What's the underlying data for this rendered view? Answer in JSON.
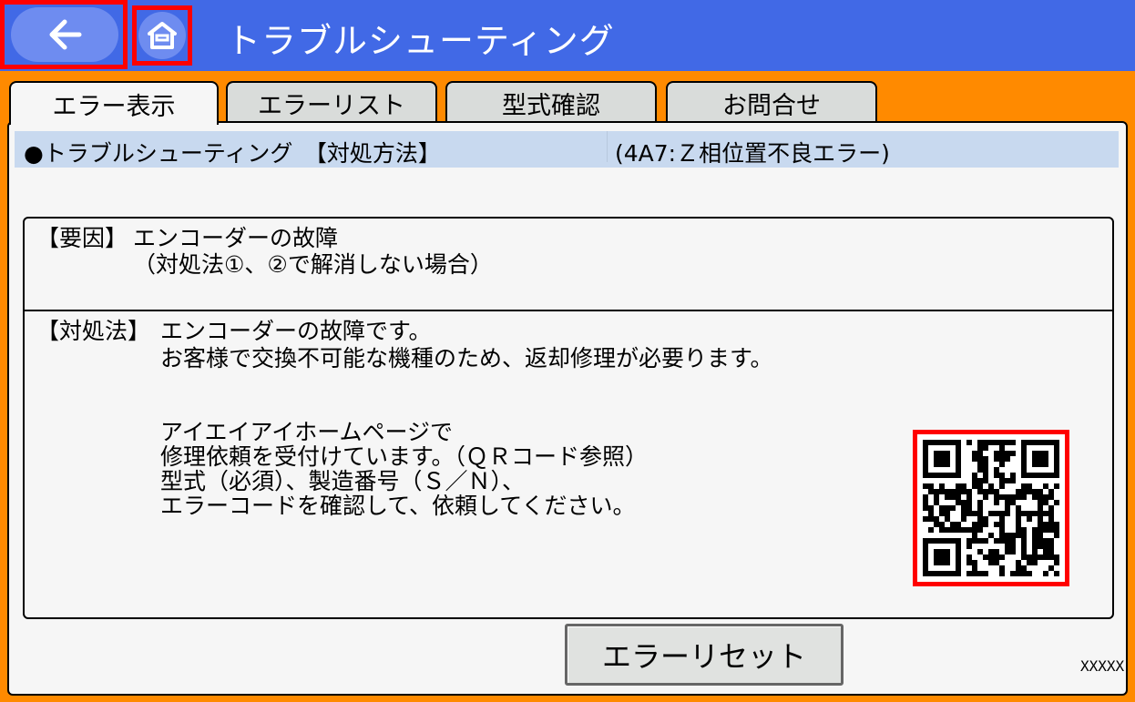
{
  "header": {
    "title": "トラブルシューティング",
    "back_icon": "arrow-left-icon",
    "home_icon": "home-icon"
  },
  "tabs": [
    {
      "label": "エラー表示",
      "active": true
    },
    {
      "label": "エラーリスト",
      "active": false
    },
    {
      "label": "型式確認",
      "active": false
    },
    {
      "label": "お問合せ",
      "active": false
    }
  ],
  "banner": {
    "left": "●トラブルシューティング　【対処方法】",
    "right": "(4A7:Ｚ相位置不良エラー)"
  },
  "cause": {
    "label": "【要因】",
    "line1": "エンコーダーの故障",
    "line2": "（対処法①、②で解消しない場合）"
  },
  "solution": {
    "label": "【対処法】",
    "line1": "エンコーダーの故障です。",
    "line2": "お客様で交換不可能な機種のため、返却修理が必要ります。",
    "line3": "アイエイアイホームページで",
    "line4": "修理依頼を受付けています。（ＱＲコード参照）",
    "line5": "型式（必須）、製造番号（Ｓ／Ｎ）、",
    "line6": "エラーコードを確認して、依頼してください。"
  },
  "reset_button": {
    "label": "エラーリセット"
  },
  "screen_code": "XXXXX",
  "colors": {
    "header_bg": "#4169E6",
    "page_bg": "#FF8A00",
    "highlight": "#FF0000",
    "banner_bg": "#C8D9EF"
  }
}
